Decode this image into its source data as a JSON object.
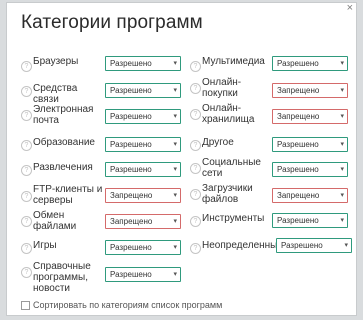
{
  "dialog": {
    "title": "Категории программ",
    "close_icon": "×"
  },
  "help_icon": "?",
  "select_arrow": "▾",
  "left_categories": [
    {
      "label": "Браузеры",
      "value": "Разрешено",
      "status": "allowed"
    },
    {
      "label": "Средства связи",
      "value": "Разрешено",
      "status": "allowed"
    },
    {
      "label": "Электронная почта",
      "value": "Разрешено",
      "status": "allowed"
    },
    {
      "label": "Образование",
      "value": "Разрешено",
      "status": "allowed"
    },
    {
      "label": "Развлечения",
      "value": "Разрешено",
      "status": "allowed"
    },
    {
      "label": "FTP-клиенты и серверы",
      "value": "Запрещено",
      "status": "denied"
    },
    {
      "label": "Обмен файлами",
      "value": "Запрещено",
      "status": "denied"
    },
    {
      "label": "Игры",
      "value": "Разрешено",
      "status": "allowed"
    },
    {
      "label": "Справочные программы, новости",
      "value": "Разрешено",
      "status": "allowed"
    }
  ],
  "right_categories": [
    {
      "label": "Мультимедиа",
      "value": "Разрешено",
      "status": "allowed"
    },
    {
      "label": "Онлайн-покупки",
      "value": "Запрещено",
      "status": "denied"
    },
    {
      "label": "Онлайн-хранилища",
      "value": "Запрещено",
      "status": "denied"
    },
    {
      "label": "Другое",
      "value": "Разрешено",
      "status": "allowed"
    },
    {
      "label": "Социальные сети",
      "value": "Разрешено",
      "status": "allowed"
    },
    {
      "label": "Загрузчики файлов",
      "value": "Запрещено",
      "status": "denied"
    },
    {
      "label": "Инструменты",
      "value": "Разрешено",
      "status": "allowed"
    },
    {
      "label": "Неопределенные",
      "value": "Разрешено",
      "status": "allowed"
    }
  ],
  "footer": {
    "sort_label": "Сортировать по категориям список программ",
    "sort_checked": false
  },
  "colors": {
    "allowed_border": "#2f9a7d",
    "denied_border": "#d46a6a"
  }
}
